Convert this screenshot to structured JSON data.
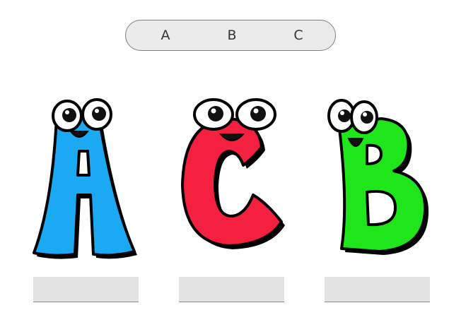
{
  "word_bank": {
    "chips": [
      "A",
      "B",
      "C"
    ]
  },
  "cartoon_letters": [
    {
      "name": "cartoon-letter-a",
      "fill_color": "#1aa9f2"
    },
    {
      "name": "cartoon-letter-c",
      "fill_color": "#f5203f"
    },
    {
      "name": "cartoon-letter-b",
      "fill_color": "#1ee61a"
    }
  ],
  "answer_boxes": [
    {
      "value": ""
    },
    {
      "value": ""
    },
    {
      "value": ""
    }
  ]
}
